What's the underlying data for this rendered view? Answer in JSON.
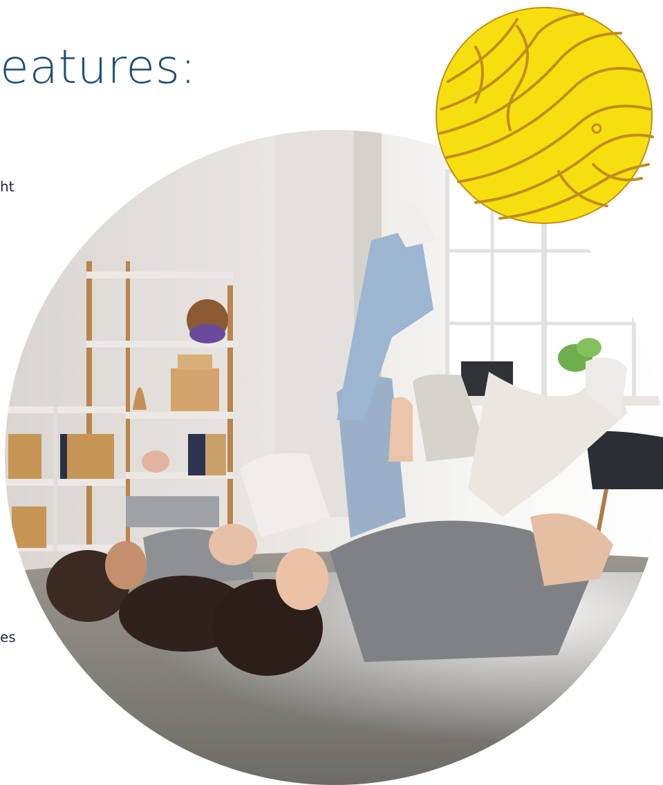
{
  "heading": {
    "text": "eatures:"
  },
  "fragments": [
    {
      "text": "ht"
    },
    {
      "text": "es"
    }
  ],
  "photo": {
    "icon": "children-lying-on-rug-photo"
  },
  "badge": {
    "icon": "topographic-lines-icon",
    "fill_color": "#f7df0f",
    "line_color": "#c08e1b"
  }
}
